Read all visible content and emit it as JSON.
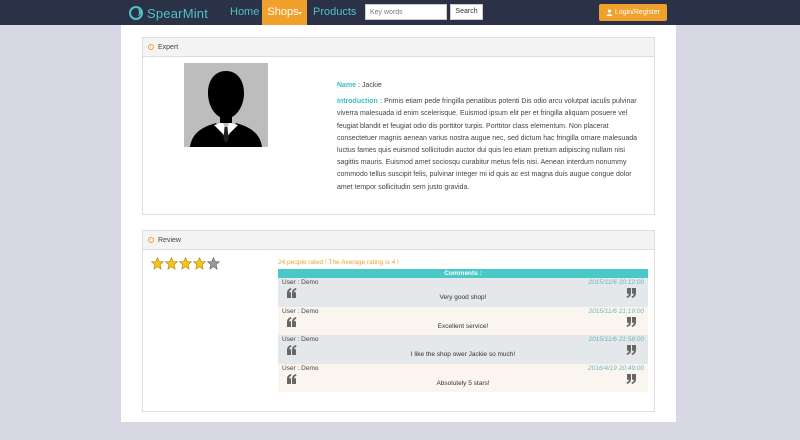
{
  "nav": {
    "brand": "SpearMint",
    "home": "Home",
    "shops": "Shops",
    "products": "Products",
    "search_placeholder": "Key words",
    "search_button": "Search",
    "login": "Login/Register"
  },
  "colors": {
    "navbar": "#2b3146",
    "accent": "#f0a12c",
    "teal": "#48c8c6"
  },
  "expert": {
    "title": "Expert",
    "name_label": "Name",
    "name": "Jackie",
    "intro_label": "Introduction",
    "intro": "Primis etiam pede fringilla penatibus potenti Dis odio arcu volutpat iaculis pulvinar viverra malesuada id enim scelerisque. Euismod ipsum elit per et fringilla aliquam posuere vel feugiat blandit et feugiat odio dis porttitor turpis. Porttitor class elementum. Non placerat consectetuer magnis aenean varius nostra augue nec, sed dictum hac fringilla ornare malesuada luctus fames quis euismod sollicitudin auctor dui quis leo etiam pretium adipiscing nullam nisi sagittis mauris. Euismod amet sociosqu curabitur metus felis nisi. Aenean interdum nonummy commodo tellus suscipit felis, pulvinar integer mi id quis ac est magna duis augue congue dolor amet tempor sollicitudin sem justo gravida."
  },
  "review": {
    "title": "Review",
    "rating": 4,
    "max_rating": 5,
    "summary": "24 people rated ! The Average rating is 4 !",
    "comments_header": "Comments :",
    "comments": [
      {
        "user": "User : Demo",
        "date": "2015/11/6 20:12:00",
        "text": "Very good shop!"
      },
      {
        "user": "User : Demo",
        "date": "2015/11/6 21:19:00",
        "text": "Excellent service!"
      },
      {
        "user": "User : Demo",
        "date": "2015/11/6 21:58:00",
        "text": "I like the shop ower Jackie so much!"
      },
      {
        "user": "User : Demo",
        "date": "2016/4/19 20:49:00",
        "text": "Absolutely 5 stars!"
      }
    ]
  }
}
